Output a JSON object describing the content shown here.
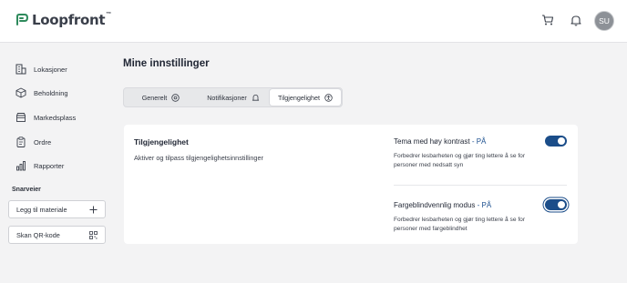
{
  "app": {
    "logo_text": "Loopfront",
    "logo_tm": "™",
    "avatar_initials": "SU",
    "header_icons": [
      "cart-icon",
      "bell-icon"
    ]
  },
  "sidebar": {
    "items": [
      {
        "label": "Lokasjoner",
        "icon": "building-icon"
      },
      {
        "label": "Beholdning",
        "icon": "box-icon"
      },
      {
        "label": "Markedsplass",
        "icon": "store-icon"
      },
      {
        "label": "Ordre",
        "icon": "clipboard-icon"
      },
      {
        "label": "Rapporter",
        "icon": "bar-chart-icon"
      }
    ],
    "shortcuts_title": "Snarveier",
    "shortcuts": [
      {
        "label": "Legg til materiale",
        "icon": "plus-icon"
      },
      {
        "label": "Skan QR-kode",
        "icon": "qr-code-icon"
      }
    ]
  },
  "main": {
    "title": "Mine innstillinger",
    "tabs": [
      {
        "label": "Generelt",
        "icon": "settings-circle-icon",
        "active": false
      },
      {
        "label": "Notifikasjoner",
        "icon": "bell-icon",
        "active": false
      },
      {
        "label": "Tilgjengelighet",
        "icon": "accessibility-icon",
        "active": true
      }
    ],
    "card": {
      "title": "Tilgjengelighet",
      "description": "Aktiver og tilpass tilgjengelighetsinnstillinger",
      "settings": [
        {
          "title": "Tema med høy kontrast",
          "state": " - PÅ",
          "description": "Forbedrer lesbarheten og gjør ting lettere å se for personer med nedsatt syn",
          "enabled": true
        },
        {
          "title": "Fargeblindvennlig modus",
          "state": " - PÅ",
          "description": "Forbedrer lesbarheten og gjør ting lettere å se for personer med fargeblindhet",
          "enabled": true
        }
      ]
    }
  },
  "colors": {
    "accent": "#1b4d89",
    "state_text": "#1b4f8f",
    "background": "#f3f3f4"
  }
}
